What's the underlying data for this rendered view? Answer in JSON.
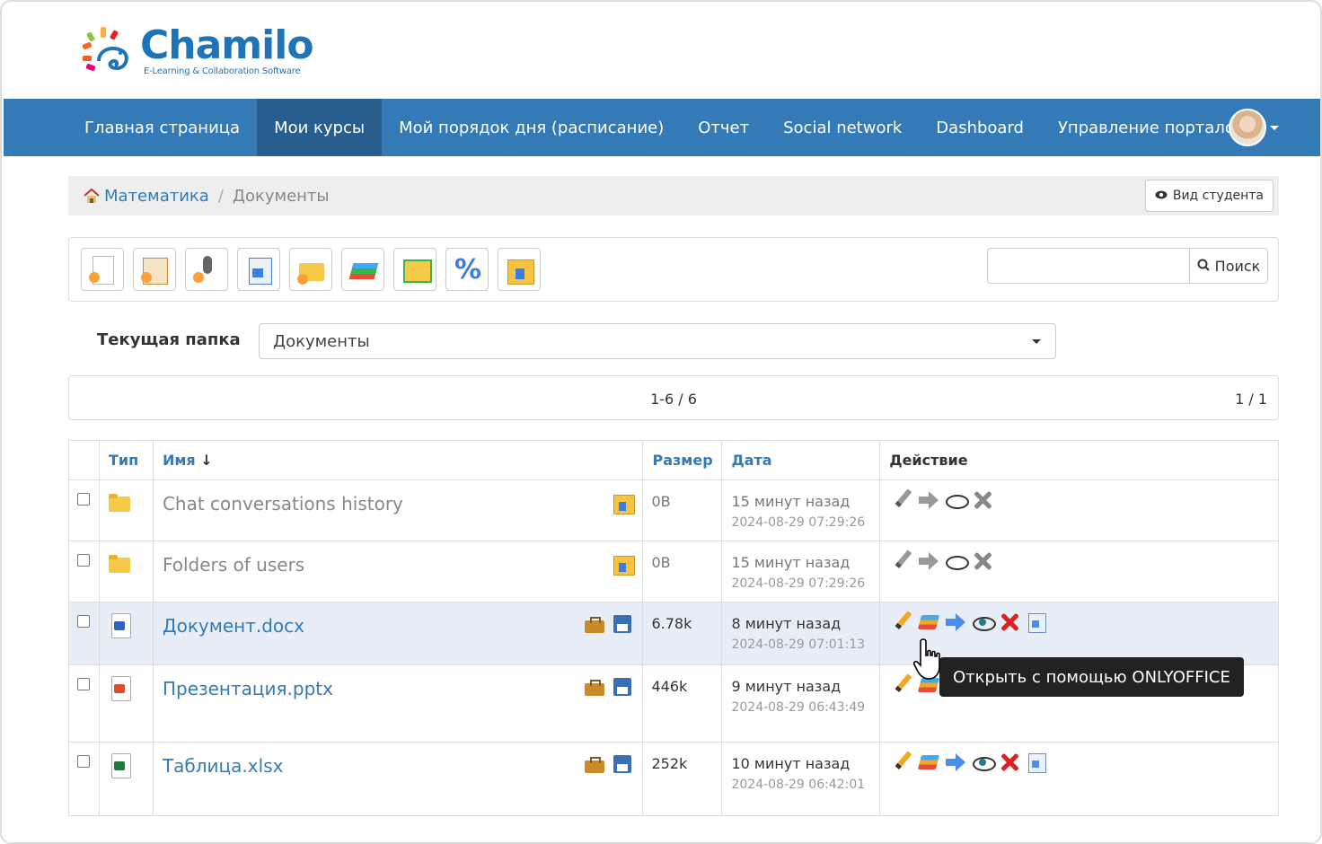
{
  "logo": {
    "name": "Chamilo",
    "tagline": "E-Learning & Collaboration Software"
  },
  "nav": {
    "items": [
      {
        "label": "Главная страница"
      },
      {
        "label": "Мои курсы",
        "active": true
      },
      {
        "label": "Мой порядок дня (расписание)"
      },
      {
        "label": "Отчет"
      },
      {
        "label": "Social network"
      },
      {
        "label": "Dashboard"
      },
      {
        "label": "Управление порталом"
      }
    ]
  },
  "breadcrumb": {
    "home": "Математика",
    "current": "Документы",
    "student_view": "Вид студента"
  },
  "toolbar": {
    "tools": [
      "create-document-icon",
      "template-icon",
      "audio-icon",
      "upload-icon",
      "new-folder-icon",
      "presentation-icon",
      "slideshow-icon",
      "quota-icon",
      "download-icon"
    ],
    "search_label": "Поиск",
    "search_value": ""
  },
  "folder": {
    "label": "Текущая папка",
    "value": "Документы"
  },
  "pager": {
    "range": "1-6 / 6",
    "pages": "1 / 1"
  },
  "table": {
    "headers": {
      "type": "Тип",
      "name": "Имя",
      "size": "Размер",
      "date": "Дата",
      "action": "Действие"
    },
    "rows": [
      {
        "name": "Chat conversations history",
        "size": "0B",
        "rel": "15 минут назад",
        "abs": "2024-08-29 07:29:26"
      },
      {
        "name": "Folders of users",
        "size": "0B",
        "rel": "15 минут назад",
        "abs": "2024-08-29 07:29:26"
      },
      {
        "name": "Документ.docx",
        "size": "6.78k",
        "rel": "8 минут назад",
        "abs": "2024-08-29 07:01:13"
      },
      {
        "name": "Презентация.pptx",
        "size": "446k",
        "rel": "9 минут назад",
        "abs": "2024-08-29 06:43:49"
      },
      {
        "name": "Таблица.xlsx",
        "size": "252k",
        "rel": "10 минут назад",
        "abs": "2024-08-29 06:42:01"
      }
    ]
  },
  "tooltip": "Открыть с помощью ONLYOFFICE",
  "colors": {
    "nav": "#337ab7",
    "nav_active": "#285e8e",
    "link": "#337ab7",
    "highlight_row": "#e8eef7"
  }
}
